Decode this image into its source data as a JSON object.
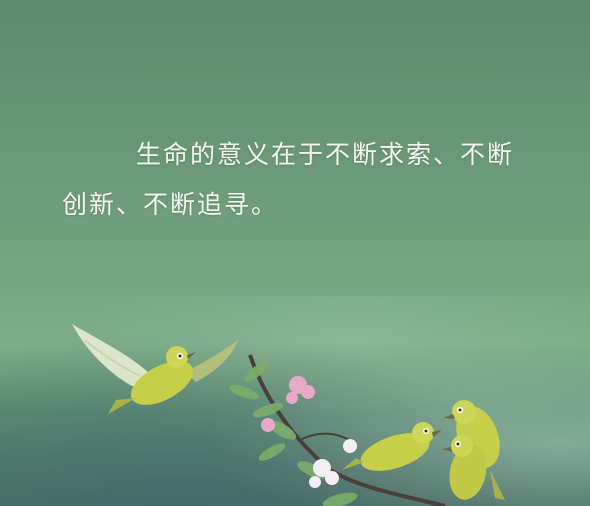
{
  "quote": {
    "text": "生命的意义在于不断求索、不断创新、不断追寻。"
  },
  "colors": {
    "sky_top": "#5f8a6c",
    "sky_mid": "#76a57f",
    "ground": "#4b6f63",
    "bird_body": "#c9d24a",
    "blossom": "#e7a9c7",
    "text": "#f4f8f2"
  },
  "scene": {
    "subjects": [
      "white-eye birds",
      "flowering branch"
    ]
  }
}
